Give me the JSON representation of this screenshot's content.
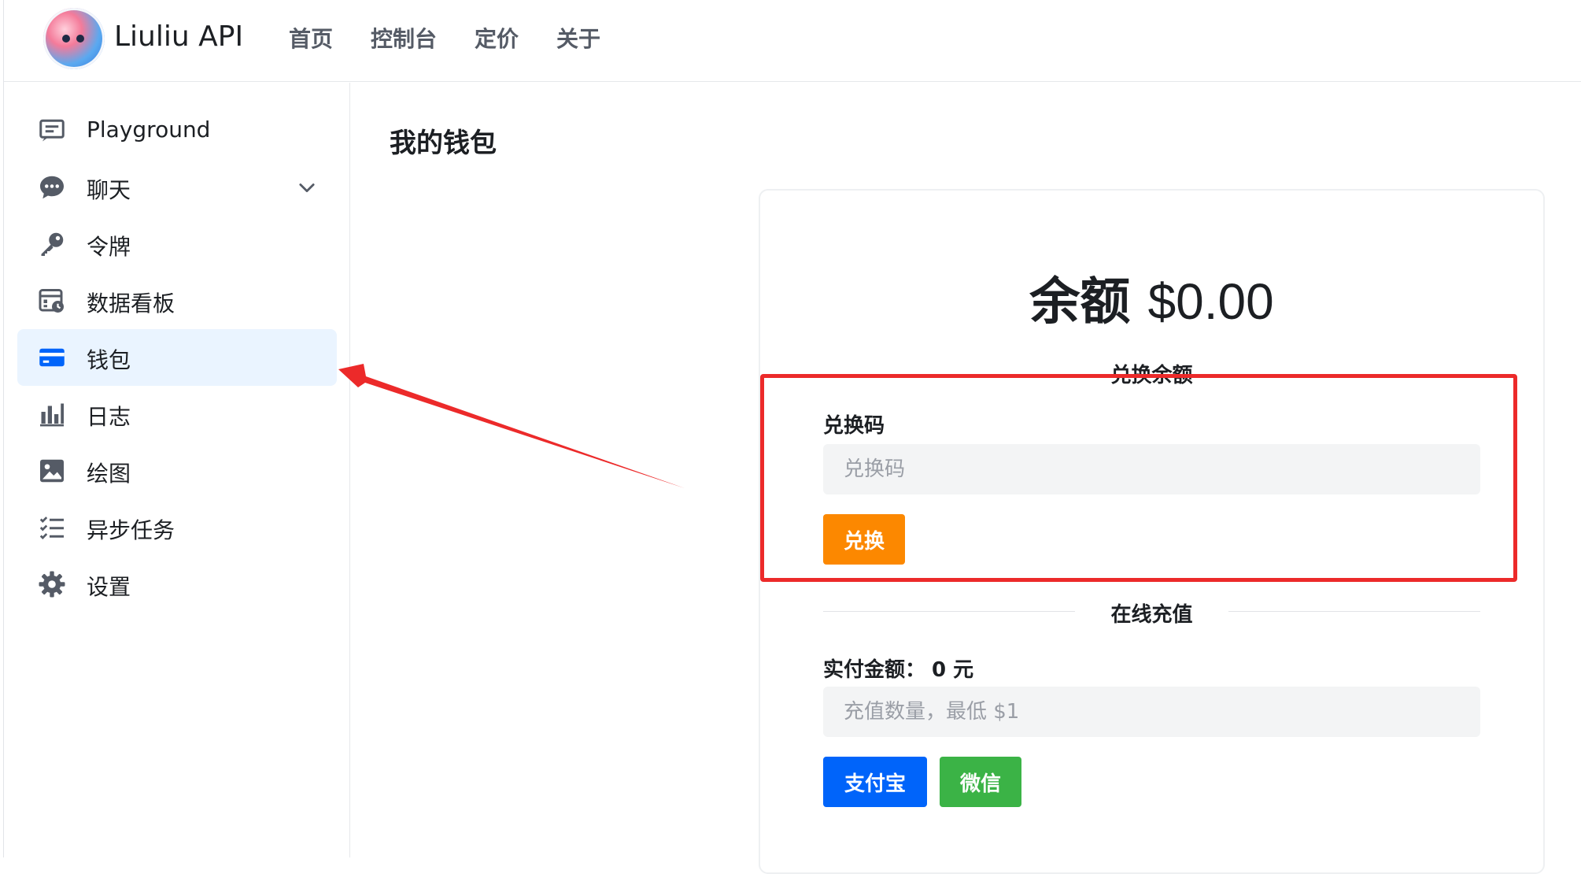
{
  "header": {
    "app_title": "Liuliu API",
    "nav": [
      "首页",
      "控制台",
      "定价",
      "关于"
    ]
  },
  "sidebar": {
    "items": [
      {
        "label": "Playground",
        "icon": "message-square-icon"
      },
      {
        "label": "聊天",
        "icon": "chat-bubble-icon",
        "expandable": true
      },
      {
        "label": "令牌",
        "icon": "key-icon"
      },
      {
        "label": "数据看板",
        "icon": "dashboard-icon"
      },
      {
        "label": "钱包",
        "icon": "credit-card-icon",
        "active": true
      },
      {
        "label": "日志",
        "icon": "bar-chart-icon"
      },
      {
        "label": "绘图",
        "icon": "image-icon"
      },
      {
        "label": "异步任务",
        "icon": "checklist-icon"
      },
      {
        "label": "设置",
        "icon": "gear-icon"
      }
    ]
  },
  "main": {
    "page_title": "我的钱包",
    "balance_label": "余额",
    "balance_value": "$0.00",
    "redeem": {
      "section_title": "兑换余额",
      "field_label": "兑换码",
      "placeholder": "兑换码",
      "button_label": "兑换"
    },
    "topup": {
      "section_title": "在线充值",
      "amount_label": "实付金额：",
      "amount_value": "0 元",
      "placeholder": "充值数量，最低 $1",
      "alipay_label": "支付宝",
      "wechat_label": "微信"
    }
  },
  "colors": {
    "accent_blue": "#0064fa",
    "redeem_orange": "#fc8800",
    "wechat_green": "#3bb346",
    "annotation_red": "#ec2a2a",
    "active_bg": "#eaf4ff"
  }
}
